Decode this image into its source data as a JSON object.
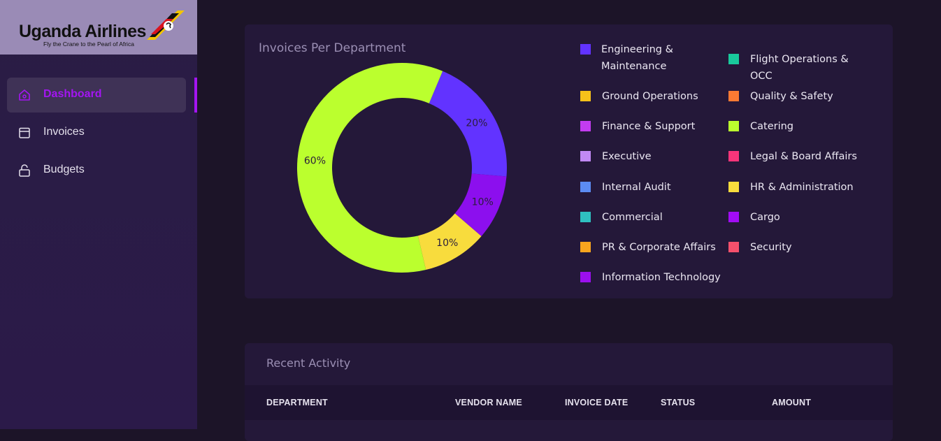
{
  "brand": {
    "name": "Uganda Airlines",
    "tagline": "Fly the Crane to the Pearl of Africa"
  },
  "nav": [
    {
      "label": "Dashboard",
      "icon": "home-icon",
      "active": true
    },
    {
      "label": "Invoices",
      "icon": "calendar-icon",
      "active": false
    },
    {
      "label": "Budgets",
      "icon": "lock-icon",
      "active": false
    }
  ],
  "colors": {
    "accent": "#a415f2",
    "sidebar": "#2a1d44",
    "card": "#241839"
  },
  "invoices_card": {
    "title": "Invoices Per Department"
  },
  "chart_data": {
    "type": "pie",
    "title": "Invoices Per Department",
    "donut": true,
    "slices": [
      {
        "label": "Engineering & Maintenance",
        "value": 20,
        "color": "#6233ff"
      },
      {
        "label": "Cargo",
        "value": 10,
        "color": "#8c0fee"
      },
      {
        "label": "HR & Administration",
        "value": 10,
        "color": "#f8dc3d"
      },
      {
        "label": "Catering",
        "value": 60,
        "color": "#bbff2e"
      }
    ],
    "slice_labels": [
      "20%",
      "10%",
      "10%",
      "60%"
    ],
    "legend_placement": "right",
    "legend": [
      {
        "label": "Engineering & Maintenance",
        "color": "#6233ff"
      },
      {
        "label": "Flight Operations & OCC",
        "color": "#19c99c"
      },
      {
        "label": "Ground Operations",
        "color": "#f6c11a"
      },
      {
        "label": "Quality & Safety",
        "color": "#fb7a33"
      },
      {
        "label": "Finance & Support",
        "color": "#c33cf0"
      },
      {
        "label": "Catering",
        "color": "#bbff2e"
      },
      {
        "label": "Executive",
        "color": "#c189f4"
      },
      {
        "label": "Legal & Board Affairs",
        "color": "#f8357a"
      },
      {
        "label": "Internal Audit",
        "color": "#5c8cf2"
      },
      {
        "label": "HR & Administration",
        "color": "#f8dc3d"
      },
      {
        "label": "Commercial",
        "color": "#2fc0c0"
      },
      {
        "label": "Cargo",
        "color": "#a20cf5"
      },
      {
        "label": "PR & Corporate Affairs",
        "color": "#f8a51e"
      },
      {
        "label": "Security",
        "color": "#f5506c"
      },
      {
        "label": "Information Technology",
        "color": "#9b0fee"
      }
    ]
  },
  "recent_activity": {
    "title": "Recent Activity",
    "columns": [
      "DEPARTMENT",
      "VENDOR NAME",
      "INVOICE DATE",
      "STATUS",
      "AMOUNT"
    ]
  }
}
